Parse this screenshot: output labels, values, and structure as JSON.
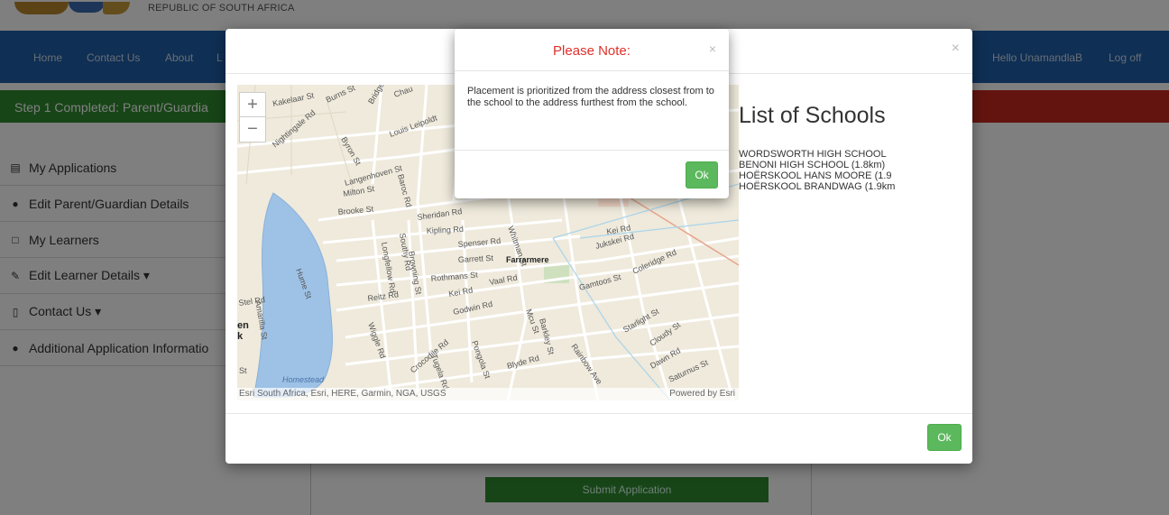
{
  "header": {
    "republic": "REPUBLIC OF SOUTH AFRICA"
  },
  "nav": {
    "home": "Home",
    "contact": "Contact Us",
    "about": "About",
    "partial": "L",
    "hello": "Hello UnamandlaB",
    "logoff": "Log off"
  },
  "status": {
    "step1": "Step 1 Completed: Parent/Guardia"
  },
  "sidebar": {
    "items": [
      {
        "label": "My Applications",
        "icon": "list-icon"
      },
      {
        "label": "Edit Parent/Guardian Details",
        "icon": "user-icon"
      },
      {
        "label": "My Learners",
        "icon": "square-icon"
      },
      {
        "label": "Edit Learner Details ▾",
        "icon": "pencil-icon"
      },
      {
        "label": "Contact Us ▾",
        "icon": "phone-icon"
      },
      {
        "label": "Additional Application Informatio",
        "icon": "user-icon"
      }
    ]
  },
  "submit_label": "Submit Application",
  "modal": {
    "close": "×",
    "list_title": "List of Schools",
    "schools": [
      "WORDSWORTH HIGH SCHOOL",
      "BENONI HIGH SCHOOL (1.8km)",
      "HOËRSKOOL HANS MOORE (1.9",
      "HOËRSKOOL BRANDWAG (1.9km"
    ],
    "ok": "Ok"
  },
  "map": {
    "zoom_in": "+",
    "zoom_out": "−",
    "attribution": "Esri South Africa, Esri, HERE, Garmin, NGA, USGS",
    "powered": "Powered by Esri",
    "labels": [
      "Kakelaar St",
      "Burns St",
      "Bridge St",
      "Chau",
      "Nightingale Rd",
      "Byron St",
      "Louis Leipoldt",
      "Baroc Rd",
      "Langenhoven St",
      "Milton St",
      "Brooke St",
      "Sheridan Rd",
      "Kipling Rd",
      "Whitman St",
      "Spenser Rd",
      "Garrett St",
      "Farrarmere",
      "Rothmans St",
      "Jukskei Rd",
      "Kei Rd",
      "Vaal Rd",
      "Kei Rd",
      "Gamtoos St",
      "Coleridge Rd",
      "Amarilla St",
      "Stel Rd",
      "Reitz Rd",
      "Godwin Rd",
      "Mcu St",
      "Barkley St",
      "Starlight St",
      "Cloudy St",
      "Rainbow Ave",
      "Blyde Rd",
      "Tugela Rd",
      "Dawn Rd",
      "Saturnus St",
      "Homestead",
      "Longfellow Rd",
      "Southy Rd",
      "Browning St",
      "Hume St",
      "Wiggle Rd",
      "Crocodile Rd",
      "Pongola St",
      "en",
      "k",
      "St"
    ]
  },
  "note": {
    "title": "Please Note:",
    "close": "×",
    "body": "Placement is prioritized from the address closest from to the school to the address furthest from the school.",
    "ok": "Ok"
  }
}
